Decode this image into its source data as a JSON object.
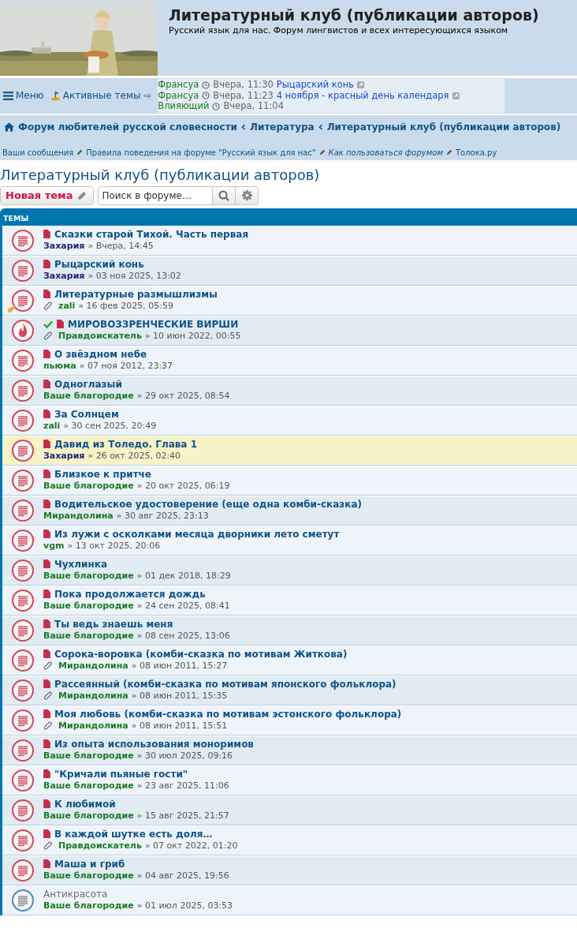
{
  "header": {
    "title": "Литературный клуб (публикации авторов)",
    "subtitle": "Русский язык для нас. Форум лингвистов и всех интересующихся языком"
  },
  "navbar": {
    "menu": "Меню",
    "active": "Активные темы ⇨",
    "ticker": [
      {
        "author": "Франсуа",
        "time": "Вчера, 11:30",
        "topic": "Рыцарский конь"
      },
      {
        "author": "Франсуа",
        "time": "Вчера, 11:23",
        "topic": "4 ноября - красный день календаря"
      },
      {
        "author": "Влияющий",
        "time": "Вчера, 11:04"
      }
    ]
  },
  "breadcrumbs": [
    "Форум любителей русской словесности",
    "Литература",
    "Литературный клуб (публикации авторов)"
  ],
  "quick_links": [
    {
      "label": "Ваши сообщения",
      "italic": false
    },
    {
      "label": "Правила поведения на форуме \"Русский язык для нас\"",
      "italic": false
    },
    {
      "label": "Как пользоваться форумом",
      "italic": true
    },
    {
      "label": "Толока.ру",
      "italic": false
    }
  ],
  "page_title": "Литературный клуб (публикации авторов)",
  "new_topic": "Новая тема",
  "search": {
    "placeholder": "Поиск в форуме…"
  },
  "table": {
    "header": "ТЕМЫ",
    "rows": [
      {
        "kind": "unread",
        "title": "Сказки старой Тихой. Часть первая",
        "author": "Захария",
        "color": "#22207a",
        "date": "» Вчера, 14:45",
        "attachment": false,
        "solved": false,
        "badge": false,
        "highlighted": false
      },
      {
        "kind": "unread",
        "title": "Рыцарский конь",
        "author": "Захария",
        "color": "#22207a",
        "date": "» 03 ноя 2025, 13:02",
        "attachment": false,
        "solved": false,
        "badge": false,
        "highlighted": false
      },
      {
        "kind": "unread",
        "title": "Литературные размышлизмы",
        "author": "zali",
        "color": "#1b7a25",
        "date": "» 16 фев 2025, 05:59",
        "attachment": true,
        "solved": false,
        "badge": true,
        "highlighted": false
      },
      {
        "kind": "hot",
        "title": "МИРОВОЗЗРЕНЧЕСКИЕ ВИРШИ",
        "author": "Правдоискатель",
        "color": "#1b7a25",
        "date": "» 10 июн 2022, 00:55",
        "attachment": true,
        "solved": true,
        "badge": false,
        "highlighted": false
      },
      {
        "kind": "unread",
        "title": "О звёздном небе",
        "author": "пьюма",
        "color": "#1b7a25",
        "date": "» 07 ноя 2012, 23:37",
        "attachment": false,
        "solved": false,
        "badge": false,
        "highlighted": false
      },
      {
        "kind": "unread",
        "title": "Одноглазый",
        "author": "Ваше благородие",
        "color": "#1b7a25",
        "date": "» 29 окт 2025, 08:54",
        "attachment": false,
        "solved": false,
        "badge": false,
        "highlighted": false
      },
      {
        "kind": "unread",
        "title": "За Солнцем",
        "author": "zali",
        "color": "#1b7a25",
        "date": "» 30 сен 2025, 20:49",
        "attachment": false,
        "solved": false,
        "badge": false,
        "highlighted": false
      },
      {
        "kind": "unread",
        "title": "Давид из Толедо. Глава 1",
        "author": "Захария",
        "color": "#22207a",
        "date": "» 26 окт 2025, 02:40",
        "attachment": false,
        "solved": false,
        "badge": false,
        "highlighted": true
      },
      {
        "kind": "unread",
        "title": "Близкое к притче",
        "author": "Ваше благородие",
        "color": "#1b7a25",
        "date": "» 20 окт 2025, 06:19",
        "attachment": false,
        "solved": false,
        "badge": false,
        "highlighted": false
      },
      {
        "kind": "unread",
        "title": "Водительское удостоверение (еще одна комби-сказка)",
        "author": "Мирандолина",
        "color": "#1b7a25",
        "date": "» 30 авг 2025, 23:13",
        "attachment": false,
        "solved": false,
        "badge": false,
        "highlighted": false
      },
      {
        "kind": "unread",
        "title": "Из лужи с осколками месяца дворники лето сметут",
        "author": "vgm",
        "color": "#1b7a25",
        "date": "» 13 окт 2025, 20:06",
        "attachment": false,
        "solved": false,
        "badge": false,
        "highlighted": false
      },
      {
        "kind": "unread",
        "title": "Чухлинка",
        "author": "Ваше благородие",
        "color": "#1b7a25",
        "date": "» 01 дек 2018, 18:29",
        "attachment": false,
        "solved": false,
        "badge": false,
        "highlighted": false
      },
      {
        "kind": "unread",
        "title": "Пока продолжается дождь",
        "author": "Ваше благородие",
        "color": "#1b7a25",
        "date": "» 24 сен 2025, 08:41",
        "attachment": false,
        "solved": false,
        "badge": false,
        "highlighted": false
      },
      {
        "kind": "unread",
        "title": "Ты ведь знаешь меня",
        "author": "Ваше благородие",
        "color": "#1b7a25",
        "date": "» 08 сен 2025, 13:06",
        "attachment": false,
        "solved": false,
        "badge": false,
        "highlighted": false
      },
      {
        "kind": "unread",
        "title": "Сорока-воровка (комби-сказка по мотивам Житкова)",
        "author": "Мирандолина",
        "color": "#1b7a25",
        "date": "» 08 июн 2011, 15:27",
        "attachment": true,
        "solved": false,
        "badge": false,
        "highlighted": false
      },
      {
        "kind": "unread",
        "title": "Рассеянный (комби-сказка по мотивам японского фольклора)",
        "author": "Мирандолина",
        "color": "#1b7a25",
        "date": "» 08 июн 2011, 15:35",
        "attachment": true,
        "solved": false,
        "badge": false,
        "highlighted": false
      },
      {
        "kind": "unread",
        "title": "Моя любовь (комби-сказка по мотивам эстонского фольклора)",
        "author": "Мирандолина",
        "color": "#1b7a25",
        "date": "» 08 июн 2011, 15:51",
        "attachment": true,
        "solved": false,
        "badge": false,
        "highlighted": false
      },
      {
        "kind": "unread",
        "title": "Из опыта использования моноримов",
        "author": "Ваше благородие",
        "color": "#1b7a25",
        "date": "» 30 июл 2025, 09:16",
        "attachment": false,
        "solved": false,
        "badge": false,
        "highlighted": false
      },
      {
        "kind": "unread",
        "title": "\"Кричали пьяные гости\"",
        "author": "Ваше благородие",
        "color": "#1b7a25",
        "date": "» 23 авг 2025, 11:06",
        "attachment": false,
        "solved": false,
        "badge": false,
        "highlighted": false
      },
      {
        "kind": "unread",
        "title": "К любимой",
        "author": "Ваше благородие",
        "color": "#1b7a25",
        "date": "» 15 авг 2025, 21:57",
        "attachment": false,
        "solved": false,
        "badge": false,
        "highlighted": false
      },
      {
        "kind": "unread",
        "title": "В каждой шутке есть доля…",
        "author": "Правдоискатель",
        "color": "#1b7a25",
        "date": "» 07 окт 2022, 01:20",
        "attachment": true,
        "solved": false,
        "badge": false,
        "highlighted": false
      },
      {
        "kind": "unread",
        "title": "Маша и гриб",
        "author": "Ваше благородие",
        "color": "#1b7a25",
        "date": "» 04 авг 2025, 19:56",
        "attachment": false,
        "solved": false,
        "badge": false,
        "highlighted": false
      },
      {
        "kind": "read",
        "title": "Антикрасота",
        "author": "Ваше благородие",
        "color": "#1b7a25",
        "date": "» 01 июл 2025, 03:53",
        "attachment": false,
        "solved": false,
        "badge": false,
        "highlighted": false
      }
    ]
  }
}
